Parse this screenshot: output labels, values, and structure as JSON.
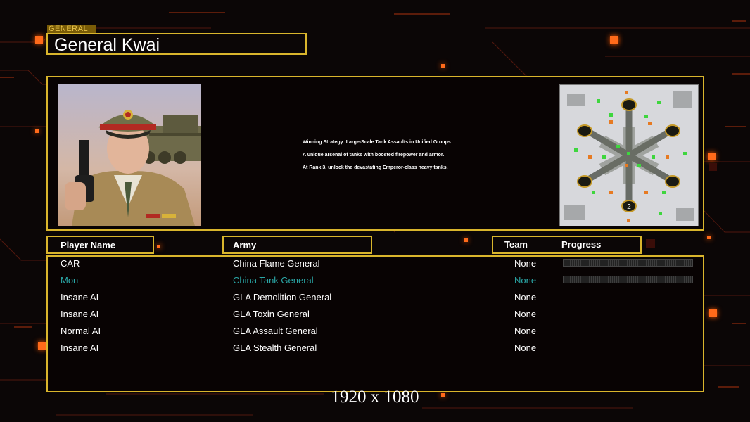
{
  "header": {
    "category_label": "GENERAL",
    "general_name": "General Kwai"
  },
  "description": {
    "lines": [
      "Winning Strategy: Large-Scale Tank Assaults in Unified Groups",
      "A unique arsenal of tanks with boosted firepower and armor.",
      "At Rank 3, unlock the devastating Emperor-class heavy tanks."
    ]
  },
  "minimap": {
    "start_marker": "2"
  },
  "columns": {
    "player_name": "Player Name",
    "army": "Army",
    "team": "Team",
    "progress": "Progress"
  },
  "players": [
    {
      "name": "CAR",
      "army": "China Flame General",
      "team": "None",
      "progress_visible": true,
      "highlight": false
    },
    {
      "name": "Mon",
      "army": "China Tank General",
      "team": "None",
      "progress_visible": true,
      "highlight": true
    },
    {
      "name": "Insane AI",
      "army": "GLA Demolition General",
      "team": "None",
      "progress_visible": false,
      "highlight": false
    },
    {
      "name": "Insane AI",
      "army": "GLA Toxin General",
      "team": "None",
      "progress_visible": false,
      "highlight": false
    },
    {
      "name": "Normal AI",
      "army": "GLA Assault General",
      "team": "None",
      "progress_visible": false,
      "highlight": false
    },
    {
      "name": "Insane AI",
      "army": "GLA Stealth General",
      "team": "None",
      "progress_visible": false,
      "highlight": false
    }
  ],
  "colors": {
    "frame": "#d9b52c",
    "highlight_text": "#2aa6a6",
    "accent_orange": "#ff6a1a"
  },
  "resolution_caption": "1920 x 1080"
}
